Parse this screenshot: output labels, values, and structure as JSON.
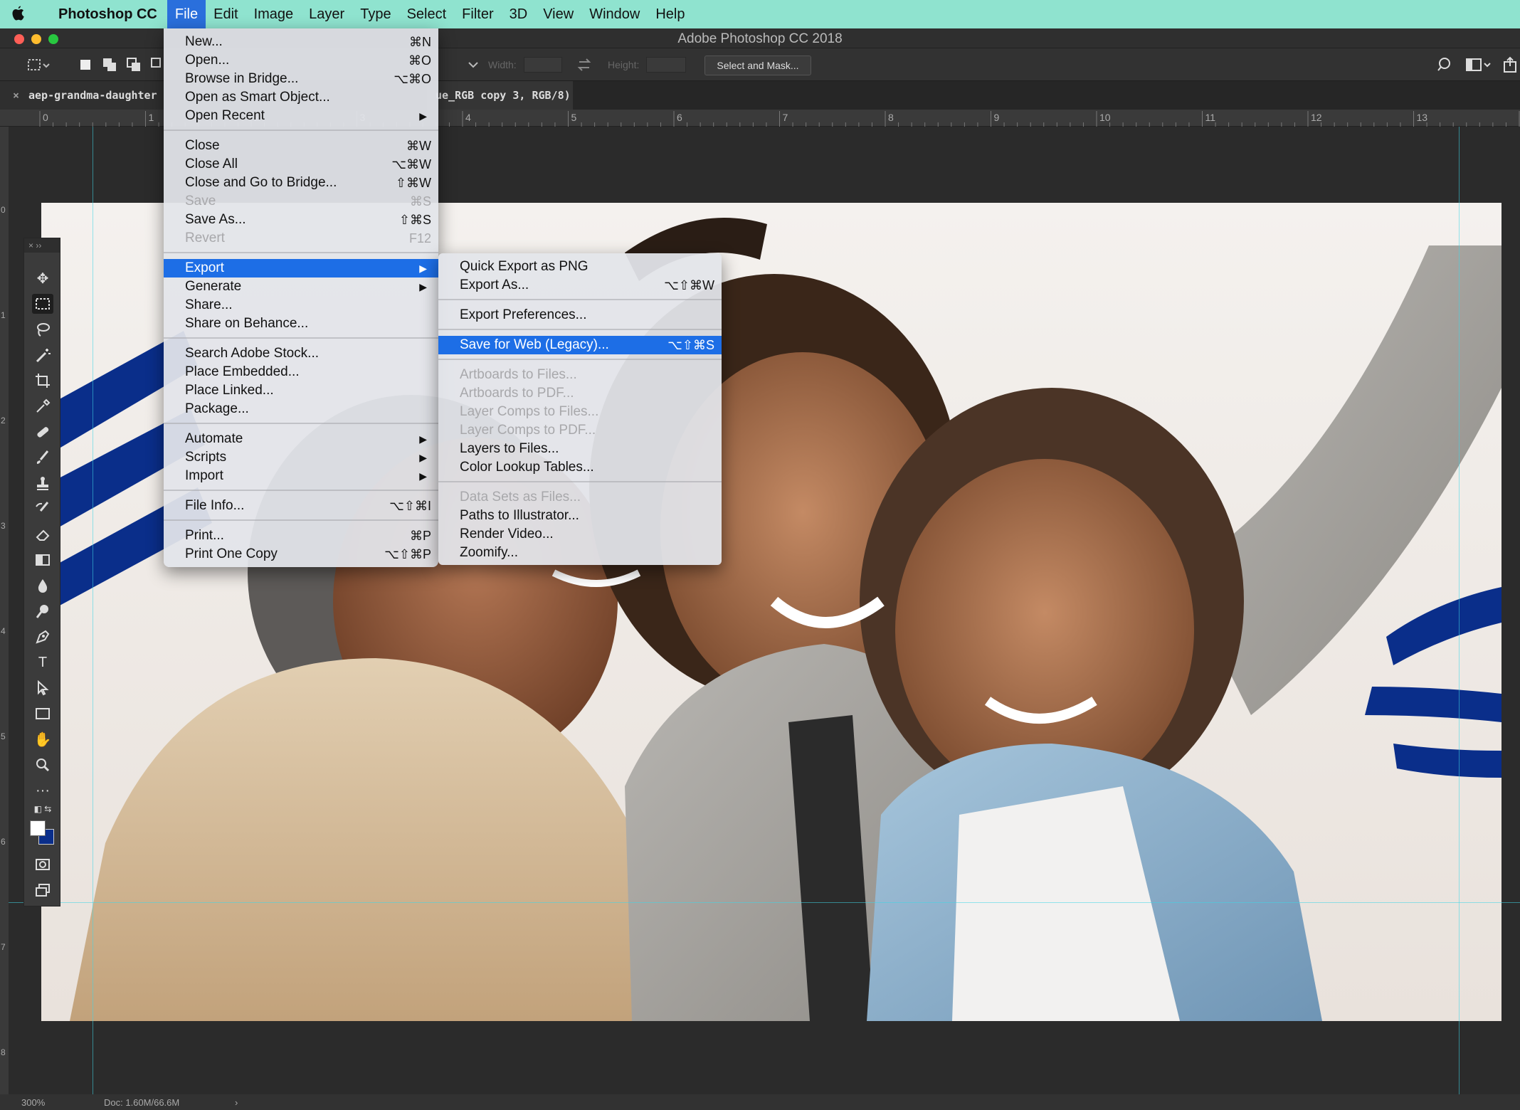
{
  "menubar": {
    "app_name": "Photoshop CC",
    "items": [
      "File",
      "Edit",
      "Image",
      "Layer",
      "Type",
      "Select",
      "Filter",
      "3D",
      "View",
      "Window",
      "Help"
    ],
    "active_item": "File"
  },
  "window": {
    "title": "Adobe Photoshop CC 2018"
  },
  "options_bar": {
    "width_label": "Width:",
    "height_label": "Height:",
    "select_mask_label": "Select and Mask..."
  },
  "tabs": {
    "doc1": "aep-grandma-daughter",
    "doc2": "ue_RGB copy 3, RGB/8)"
  },
  "ruler": {
    "marks": [
      "0",
      "1",
      "2",
      "3",
      "4",
      "5",
      "6",
      "7",
      "8",
      "9",
      "10",
      "11",
      "12",
      "13"
    ],
    "vmarks": [
      "0",
      "1",
      "2",
      "3",
      "4",
      "5",
      "6",
      "7",
      "8"
    ]
  },
  "file_menu": {
    "items": [
      {
        "label": "New...",
        "shortcut": "⌘N"
      },
      {
        "label": "Open...",
        "shortcut": "⌘O"
      },
      {
        "label": "Browse in Bridge...",
        "shortcut": "⌥⌘O"
      },
      {
        "label": "Open as Smart Object...",
        "shortcut": ""
      },
      {
        "label": "Open Recent",
        "shortcut": "",
        "submenu": true
      },
      {
        "label": "Close",
        "shortcut": "⌘W"
      },
      {
        "label": "Close All",
        "shortcut": "⌥⌘W"
      },
      {
        "label": "Close and Go to Bridge...",
        "shortcut": "⇧⌘W"
      },
      {
        "label": "Save",
        "shortcut": "⌘S",
        "disabled": true
      },
      {
        "label": "Save As...",
        "shortcut": "⇧⌘S"
      },
      {
        "label": "Revert",
        "shortcut": "F12",
        "disabled": true
      },
      {
        "label": "Export",
        "shortcut": "",
        "submenu": true,
        "highlight": true
      },
      {
        "label": "Generate",
        "shortcut": "",
        "submenu": true
      },
      {
        "label": "Share...",
        "shortcut": ""
      },
      {
        "label": "Share on Behance...",
        "shortcut": ""
      },
      {
        "label": "Search Adobe Stock...",
        "shortcut": ""
      },
      {
        "label": "Place Embedded...",
        "shortcut": ""
      },
      {
        "label": "Place Linked...",
        "shortcut": ""
      },
      {
        "label": "Package...",
        "shortcut": ""
      },
      {
        "label": "Automate",
        "shortcut": "",
        "submenu": true
      },
      {
        "label": "Scripts",
        "shortcut": "",
        "submenu": true
      },
      {
        "label": "Import",
        "shortcut": "",
        "submenu": true
      },
      {
        "label": "File Info...",
        "shortcut": "⌥⇧⌘I"
      },
      {
        "label": "Print...",
        "shortcut": "⌘P"
      },
      {
        "label": "Print One Copy",
        "shortcut": "⌥⇧⌘P"
      }
    ]
  },
  "export_menu": {
    "items": [
      {
        "label": "Quick Export as PNG",
        "shortcut": ""
      },
      {
        "label": "Export As...",
        "shortcut": "⌥⇧⌘W"
      },
      {
        "label": "Export Preferences...",
        "shortcut": ""
      },
      {
        "label": "Save for Web (Legacy)...",
        "shortcut": "⌥⇧⌘S",
        "highlight": true
      },
      {
        "label": "Artboards to Files...",
        "shortcut": "",
        "disabled": true
      },
      {
        "label": "Artboards to PDF...",
        "shortcut": "",
        "disabled": true
      },
      {
        "label": "Layer Comps to Files...",
        "shortcut": "",
        "disabled": true
      },
      {
        "label": "Layer Comps to PDF...",
        "shortcut": "",
        "disabled": true
      },
      {
        "label": "Layers to Files...",
        "shortcut": ""
      },
      {
        "label": "Color Lookup Tables...",
        "shortcut": ""
      },
      {
        "label": "Data Sets as Files...",
        "shortcut": "",
        "disabled": true
      },
      {
        "label": "Paths to Illustrator...",
        "shortcut": ""
      },
      {
        "label": "Render Video...",
        "shortcut": ""
      },
      {
        "label": "Zoomify...",
        "shortcut": ""
      }
    ]
  },
  "status": {
    "zoom": "300%",
    "doc": "Doc: 1.60M/66.6M",
    "arrow": "›"
  },
  "colors": {
    "menubar_bg": "#8fe3cf",
    "highlight": "#1d6ee6",
    "stripe_blue": "#0a2e8a"
  }
}
